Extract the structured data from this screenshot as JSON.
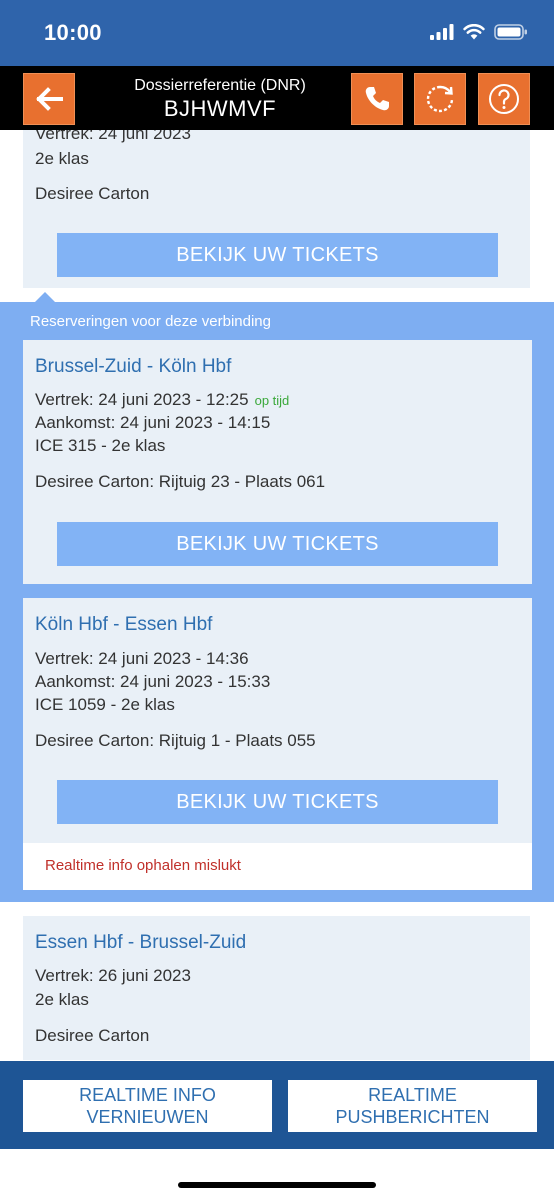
{
  "status_bar": {
    "time": "10:00"
  },
  "header": {
    "label": "Dossierreferentie (DNR)",
    "reference": "BJHWMVF",
    "back_icon": "arrow-left-icon",
    "phone_icon": "phone-icon",
    "refresh_icon": "refresh-icon",
    "help_icon": "help-icon",
    "button_color": "#e8702f"
  },
  "top_card": {
    "departure": "Vertrek: 24 juni 2023",
    "class": "2e klas",
    "passenger": "Desiree Carton",
    "button": "BEKIJK UW TICKETS"
  },
  "reservations": {
    "heading": "Reserveringen voor deze verbinding",
    "items": [
      {
        "route": "Brussel-Zuid - Köln Hbf",
        "departure": "Vertrek: 24 juni 2023 - 12:25",
        "status": "op tijd",
        "arrival": "Aankomst: 24 juni 2023 - 14:15",
        "train": "ICE 315 - 2e klas",
        "seat": "Desiree Carton: Rijtuig 23 - Plaats 061",
        "button": "BEKIJK UW TICKETS"
      },
      {
        "route": "Köln Hbf - Essen Hbf",
        "departure": "Vertrek: 24 juni 2023 - 14:36",
        "arrival": "Aankomst: 24 juni 2023 - 15:33",
        "train": "ICE 1059 - 2e klas",
        "seat": "Desiree Carton: Rijtuig 1 - Plaats 055",
        "button": "BEKIJK UW TICKETS",
        "error": "Realtime info ophalen mislukt"
      }
    ]
  },
  "return_card": {
    "route": "Essen Hbf - Brussel-Zuid",
    "departure": "Vertrek: 26 juni 2023",
    "class": "2e klas",
    "passenger": "Desiree Carton"
  },
  "bottom_bar": {
    "refresh_line1": "REALTIME INFO",
    "refresh_line2": "VERNIEUWEN",
    "push_line1": "REALTIME",
    "push_line2": "PUSHBERICHTEN"
  }
}
